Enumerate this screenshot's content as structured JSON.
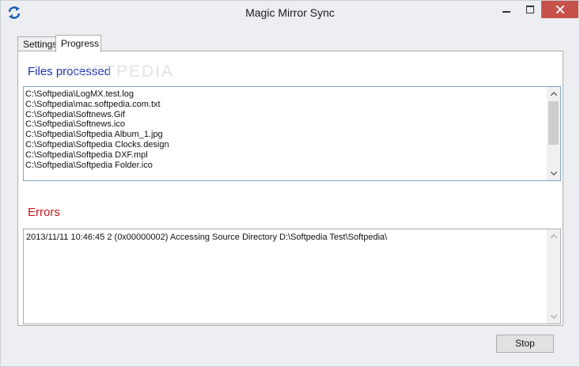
{
  "window": {
    "title": "Magic Mirror Sync",
    "app_icon": "sync-arrows-icon",
    "accent": "#1f5fb5"
  },
  "tabs": [
    {
      "label": "Settings",
      "active": false
    },
    {
      "label": "Progress",
      "active": true
    }
  ],
  "files": {
    "label": "Files processed",
    "label_color": "#1c2fb0",
    "items": [
      "C:\\Softpedia\\LogMX.test.log",
      "C:\\Softpedia\\mac.softpedia.com.txt",
      "C:\\Softpedia\\Softnews.Gif",
      "C:\\Softpedia\\Softnews.ico",
      "C:\\Softpedia\\Softpedia Album_1.jpg",
      "C:\\Softpedia\\Softpedia Clocks.design",
      "C:\\Softpedia\\Softpedia DXF.mpl",
      "C:\\Softpedia\\Softpedia Folder.ico"
    ]
  },
  "errors": {
    "label": "Errors",
    "label_color": "#c4161c",
    "items": [
      "2013/11/11 10:46:45  2 (0x00000002) Accessing Source Directory D:\\Softpedia Test\\Softpedia\\"
    ]
  },
  "buttons": {
    "stop": "Stop"
  },
  "watermark": "SOFTPEDIA"
}
